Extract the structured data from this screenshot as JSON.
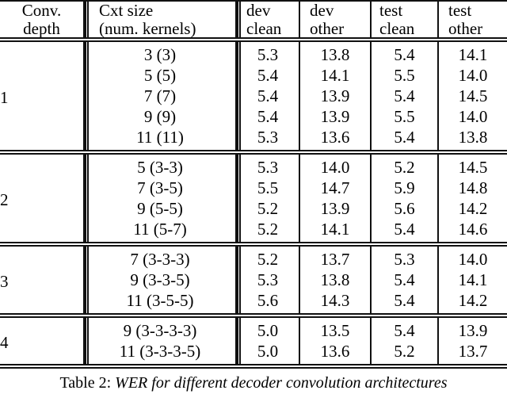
{
  "figure": {
    "kind": "results-table",
    "caption_label": "Table 2:",
    "caption_text": "WER for different decoder convolution architectures"
  },
  "table": {
    "columns": [
      {
        "id": "conv_depth",
        "line1": "Conv.",
        "line2": "depth"
      },
      {
        "id": "cxt_size",
        "line1": "Cxt size",
        "line2": "(num. kernels)"
      },
      {
        "id": "dev_clean",
        "line1": "dev",
        "line2": "clean"
      },
      {
        "id": "dev_other",
        "line1": "dev",
        "line2": "other"
      },
      {
        "id": "test_clean",
        "line1": "test",
        "line2": "clean"
      },
      {
        "id": "test_other",
        "line1": "test",
        "line2": "other"
      }
    ],
    "blocks": [
      {
        "depth": "1",
        "rows": [
          {
            "cxt": "3 (3)",
            "dev_clean": "5.3",
            "dev_other": "13.8",
            "test_clean": "5.4",
            "test_other": "14.1"
          },
          {
            "cxt": "5 (5)",
            "dev_clean": "5.4",
            "dev_other": "14.1",
            "test_clean": "5.5",
            "test_other": "14.0"
          },
          {
            "cxt": "7 (7)",
            "dev_clean": "5.4",
            "dev_other": "13.9",
            "test_clean": "5.4",
            "test_other": "14.5"
          },
          {
            "cxt": "9 (9)",
            "dev_clean": "5.4",
            "dev_other": "13.9",
            "test_clean": "5.5",
            "test_other": "14.0"
          },
          {
            "cxt": "11 (11)",
            "dev_clean": "5.3",
            "dev_other": "13.6",
            "test_clean": "5.4",
            "test_other": "13.8"
          }
        ]
      },
      {
        "depth": "2",
        "rows": [
          {
            "cxt": "5 (3-3)",
            "dev_clean": "5.3",
            "dev_other": "14.0",
            "test_clean": "5.2",
            "test_other": "14.5"
          },
          {
            "cxt": "7 (3-5)",
            "dev_clean": "5.5",
            "dev_other": "14.7",
            "test_clean": "5.9",
            "test_other": "14.8"
          },
          {
            "cxt": "9 (5-5)",
            "dev_clean": "5.2",
            "dev_other": "13.9",
            "test_clean": "5.6",
            "test_other": "14.2"
          },
          {
            "cxt": "11 (5-7)",
            "dev_clean": "5.2",
            "dev_other": "14.1",
            "test_clean": "5.4",
            "test_other": "14.6"
          }
        ]
      },
      {
        "depth": "3",
        "rows": [
          {
            "cxt": "7 (3-3-3)",
            "dev_clean": "5.2",
            "dev_other": "13.7",
            "test_clean": "5.3",
            "test_other": "14.0"
          },
          {
            "cxt": "9 (3-3-5)",
            "dev_clean": "5.3",
            "dev_other": "13.8",
            "test_clean": "5.4",
            "test_other": "14.1"
          },
          {
            "cxt": "11 (3-5-5)",
            "dev_clean": "5.6",
            "dev_other": "14.3",
            "test_clean": "5.4",
            "test_other": "14.2"
          }
        ]
      },
      {
        "depth": "4",
        "rows": [
          {
            "cxt": "9 (3-3-3-3)",
            "dev_clean": "5.0",
            "dev_other": "13.5",
            "test_clean": "5.4",
            "test_other": "13.9"
          },
          {
            "cxt": "11 (3-3-3-5)",
            "dev_clean": "5.0",
            "dev_other": "13.6",
            "test_clean": "5.2",
            "test_other": "13.7"
          }
        ]
      }
    ]
  },
  "style": {
    "rule_color": "#111111",
    "text_color": "#000000",
    "background": "#ffffff"
  }
}
